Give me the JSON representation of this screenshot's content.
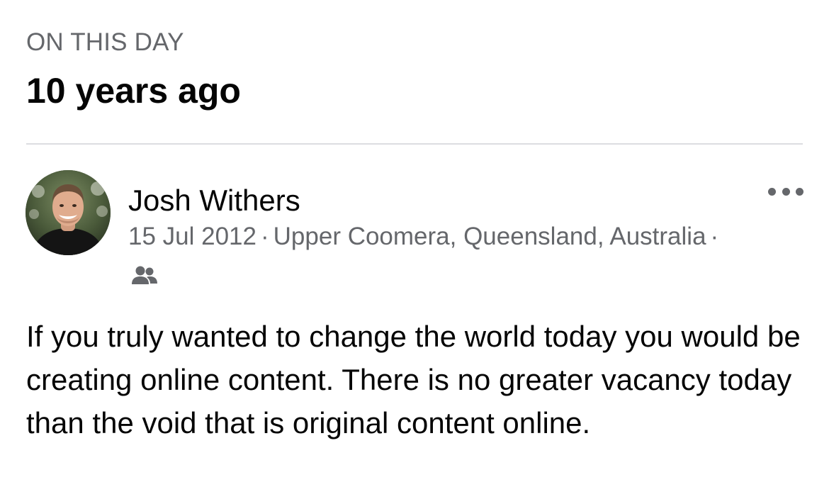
{
  "memory": {
    "eyebrow": "ON THIS DAY",
    "headline": "10 years ago"
  },
  "post": {
    "author": "Josh Withers",
    "date": "15 Jul 2012",
    "location": "Upper Coomera, Queensland, Australia",
    "separator": "·",
    "audience_icon": "friends-icon",
    "more_icon": "more-options-icon",
    "text": "If you truly wanted to change the world today you would be creating online content. There is no greater vacancy today than the void that is original content online."
  },
  "colors": {
    "primary_text": "#050505",
    "secondary_text": "#65676b",
    "divider": "#dcdde1",
    "background": "#ffffff"
  }
}
